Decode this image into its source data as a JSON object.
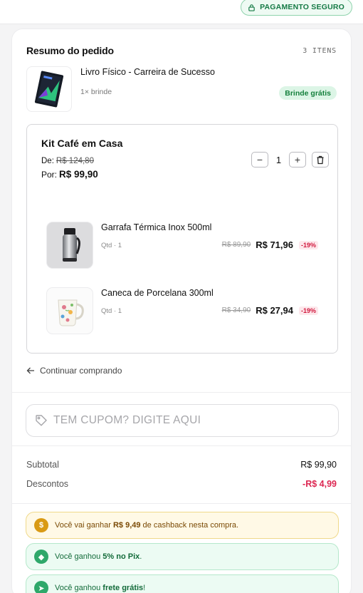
{
  "header": {
    "secure_badge": "PAGAMENTO SEGURO",
    "lock_icon": "lock-icon"
  },
  "summary": {
    "title": "Resumo do pedido",
    "item_count": "3 ITENS"
  },
  "gift": {
    "name": "Livro Físico - Carreira de Sucesso",
    "sub": "1× brinde",
    "badge": "Brinde grátis"
  },
  "kit": {
    "title": "Kit Café em Casa",
    "de_label": "De:",
    "de_value": "R$ 124,80",
    "por_label": "Por:",
    "por_value": "R$ 99,90",
    "quantity": "1",
    "items": [
      {
        "name": "Garrafa Térmica Inox 500ml",
        "qty": "Qtd · 1",
        "old_price": "R$ 89,90",
        "price": "R$ 71,96",
        "discount": "-19%"
      },
      {
        "name": "Caneca de Porcelana 300ml",
        "qty": "Qtd · 1",
        "old_price": "R$ 34,90",
        "price": "R$ 27,94",
        "discount": "-19%"
      }
    ]
  },
  "continue_label": "Continuar comprando",
  "coupon": {
    "placeholder": "TEM CUPOM? DIGITE AQUI"
  },
  "totals": {
    "subtotal_label": "Subtotal",
    "subtotal_value": "R$ 99,90",
    "discount_label": "Descontos",
    "discount_value": "-R$ 4,99"
  },
  "promos": {
    "cashback_pre": "Você vai ganhar",
    "cashback_amount": "R$ 9,49",
    "cashback_post": "de cashback nesta compra.",
    "pix_pre": "Você ganhou",
    "pix_bold": "5% no Pix",
    "pix_post": ".",
    "frete_pre": "Você ganhou",
    "frete_bold": "frete grátis",
    "frete_post": "!"
  },
  "colors": {
    "accent_green": "#15803d",
    "discount_red": "#dc2651",
    "cashback_gold": "#d99a14"
  }
}
